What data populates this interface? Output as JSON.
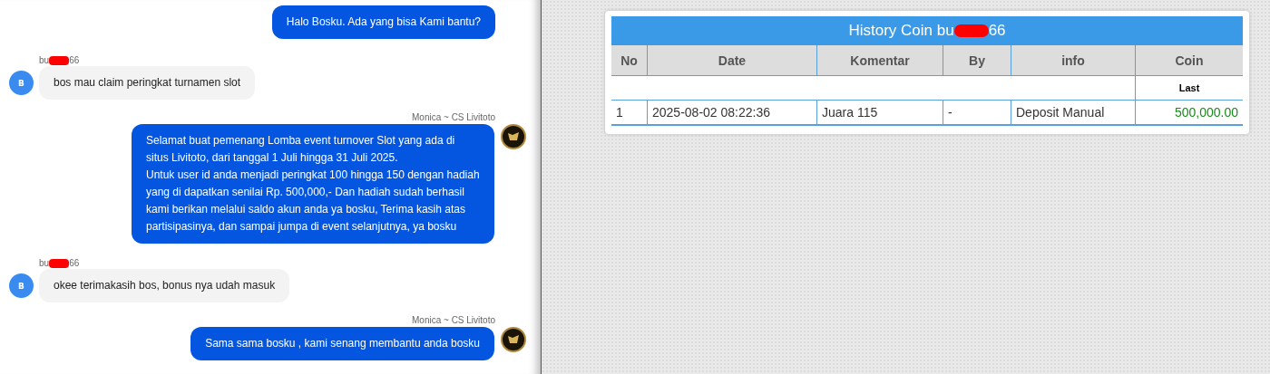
{
  "chat": {
    "messages": [
      {
        "kind": "agent",
        "text": "Halo Bosku. Ada yang bisa Kami bantu?",
        "avatar": false
      },
      {
        "kind": "user",
        "sender_start": "bu",
        "sender_end": "66",
        "avatar_letter": "B",
        "text": "bos mau claim peringkat turnamen slot"
      },
      {
        "kind": "agent",
        "sender": "Monica ~ CS Livitoto",
        "text": "Selamat buat pemenang Lomba event turnover Slot yang ada di situs Livitoto, dari tanggal 1 Juli hingga 31 Juli 2025.\nUntuk user id anda menjadi peringkat 100 hingga 150 dengan hadiah yang di dapatkan senilai Rp. 500,000,- Dan hadiah sudah berhasil kami berikan melalui saldo akun anda ya bosku, Terima kasih atas partisipasinya, dan sampai jumpa di event selanjutnya, ya bosku",
        "avatar": true
      },
      {
        "kind": "user",
        "sender_start": "bu",
        "sender_end": "66",
        "avatar_letter": "B",
        "text": "okee terimakasih bos, bonus nya udah masuk"
      },
      {
        "kind": "agent",
        "sender": "Monica ~ CS Livitoto",
        "text": "Sama sama bosku , kami senang membantu anda bosku",
        "avatar": true
      }
    ]
  },
  "history": {
    "title_start": "History Coin bu",
    "title_end": "66",
    "columns": [
      "No",
      "Date",
      "Komentar",
      "By",
      "info",
      "Coin"
    ],
    "subheader": "Last",
    "rows": [
      {
        "cells": [
          "1",
          "2025-08-02 08:22:36",
          "Juara 115",
          "-",
          "Deposit Manual",
          "500,000.00"
        ]
      }
    ]
  }
}
